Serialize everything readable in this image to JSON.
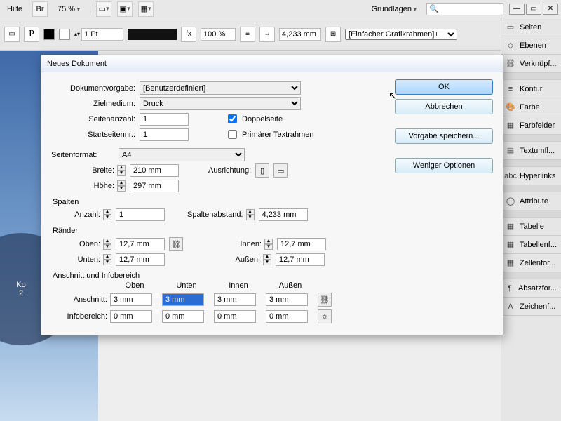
{
  "menu": {
    "help": "Hilfe",
    "bridge": "Br",
    "zoom": "75 %",
    "workspace": "Grundlagen",
    "searchPlaceholder": ""
  },
  "toolbelt": {
    "strokeWeight": "1 Pt",
    "percent": "100 %",
    "measureValue": "4,233 mm",
    "frameOption": "[Einfacher Grafikrahmen]+"
  },
  "preview": {
    "line1": "Ko",
    "line2": "2"
  },
  "panels": [
    {
      "icon": "▭",
      "label": "Seiten"
    },
    {
      "icon": "◇",
      "label": "Ebenen"
    },
    {
      "icon": "⛓",
      "label": "Verknüpf..."
    },
    {
      "spacer": true
    },
    {
      "icon": "≡",
      "label": "Kontur"
    },
    {
      "icon": "🎨",
      "label": "Farbe"
    },
    {
      "icon": "▦",
      "label": "Farbfelder"
    },
    {
      "spacer": true
    },
    {
      "icon": "▤",
      "label": "Textumfl..."
    },
    {
      "spacer": true
    },
    {
      "icon": "abc",
      "label": "Hyperlinks"
    },
    {
      "spacer": true
    },
    {
      "icon": "◯",
      "label": "Attribute"
    },
    {
      "spacer": true
    },
    {
      "icon": "▦",
      "label": "Tabelle"
    },
    {
      "icon": "▦",
      "label": "Tabellenf..."
    },
    {
      "icon": "▦",
      "label": "Zellenfor..."
    },
    {
      "spacer": true
    },
    {
      "icon": "¶",
      "label": "Absatzfor..."
    },
    {
      "icon": "A",
      "label": "Zeichenf..."
    }
  ],
  "dialog": {
    "title": "Neues Dokument",
    "labels": {
      "preset": "Dokumentvorgabe:",
      "intent": "Zielmedium:",
      "pages": "Seitenanzahl:",
      "startPage": "Startseitennr.:",
      "facing": "Doppelseite",
      "primaryFrame": "Primärer Textrahmen",
      "pageSize": "Seitenformat:",
      "width": "Breite:",
      "height": "Höhe:",
      "orientation": "Ausrichtung:",
      "columns": "Spalten",
      "colCount": "Anzahl:",
      "gutter": "Spaltenabstand:",
      "margins": "Ränder",
      "top": "Oben:",
      "bottom": "Unten:",
      "inside": "Innen:",
      "outside": "Außen:",
      "bleedSlug": "Anschnitt und Infobereich",
      "bleed": "Anschnitt:",
      "slug": "Infobereich:",
      "hTop": "Oben",
      "hBottom": "Unten",
      "hInside": "Innen",
      "hOutside": "Außen"
    },
    "values": {
      "preset": "[Benutzerdefiniert]",
      "intent": "Druck",
      "pages": "1",
      "startPage": "1",
      "facing": true,
      "primaryFrame": false,
      "pageSize": "A4",
      "width": "210 mm",
      "height": "297 mm",
      "colCount": "1",
      "gutter": "4,233 mm",
      "marginTop": "12,7 mm",
      "marginBottom": "12,7 mm",
      "marginInside": "12,7 mm",
      "marginOutside": "12,7 mm",
      "bleed": [
        "3 mm",
        "3 mm",
        "3 mm",
        "3 mm"
      ],
      "slug": [
        "0 mm",
        "0 mm",
        "0 mm",
        "0 mm"
      ]
    },
    "buttons": {
      "ok": "OK",
      "cancel": "Abbrechen",
      "savePreset": "Vorgabe speichern...",
      "fewerOptions": "Weniger Optionen"
    }
  }
}
